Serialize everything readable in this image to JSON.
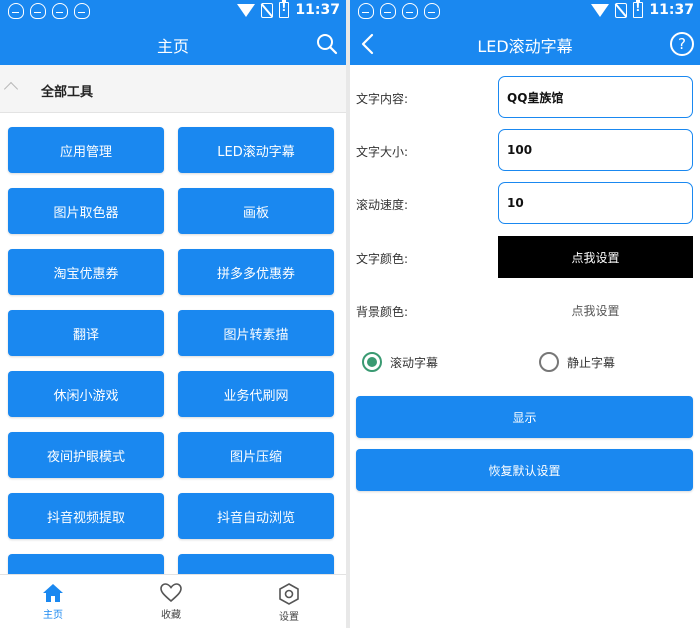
{
  "status_bar": {
    "time": "11:37"
  },
  "colors": {
    "primary": "#1a88f0",
    "radio_checked": "#3a9a72",
    "text_color_swatch": "#000000"
  },
  "left_screen": {
    "title": "主页",
    "search_icon": "search-icon",
    "section_title": "全部工具",
    "tools": [
      "应用管理",
      "LED滚动字幕",
      "图片取色器",
      "画板",
      "淘宝优惠券",
      "拼多多优惠券",
      "翻译",
      "图片转素描",
      "休闲小游戏",
      "业务代刷网",
      "夜间护眼模式",
      "图片压缩",
      "抖音视频提取",
      "抖音自动浏览"
    ],
    "nav": [
      {
        "label": "主页",
        "icon": "home-icon"
      },
      {
        "label": "收藏",
        "icon": "heart-icon"
      },
      {
        "label": "设置",
        "icon": "settings-icon"
      }
    ]
  },
  "right_screen": {
    "title": "LED滚动字幕",
    "fields": {
      "text_content": {
        "label": "文字内容:",
        "value": "QQ皇族馆"
      },
      "text_size": {
        "label": "文字大小:",
        "value": "100"
      },
      "scroll_speed": {
        "label": "滚动速度:",
        "value": "10"
      },
      "text_color": {
        "label": "文字颜色:",
        "button": "点我设置"
      },
      "bg_color": {
        "label": "背景颜色:",
        "button": "点我设置"
      }
    },
    "radios": {
      "scroll": "滚动字幕",
      "static": "静止字幕"
    },
    "buttons": {
      "show": "显示",
      "reset": "恢复默认设置"
    }
  }
}
